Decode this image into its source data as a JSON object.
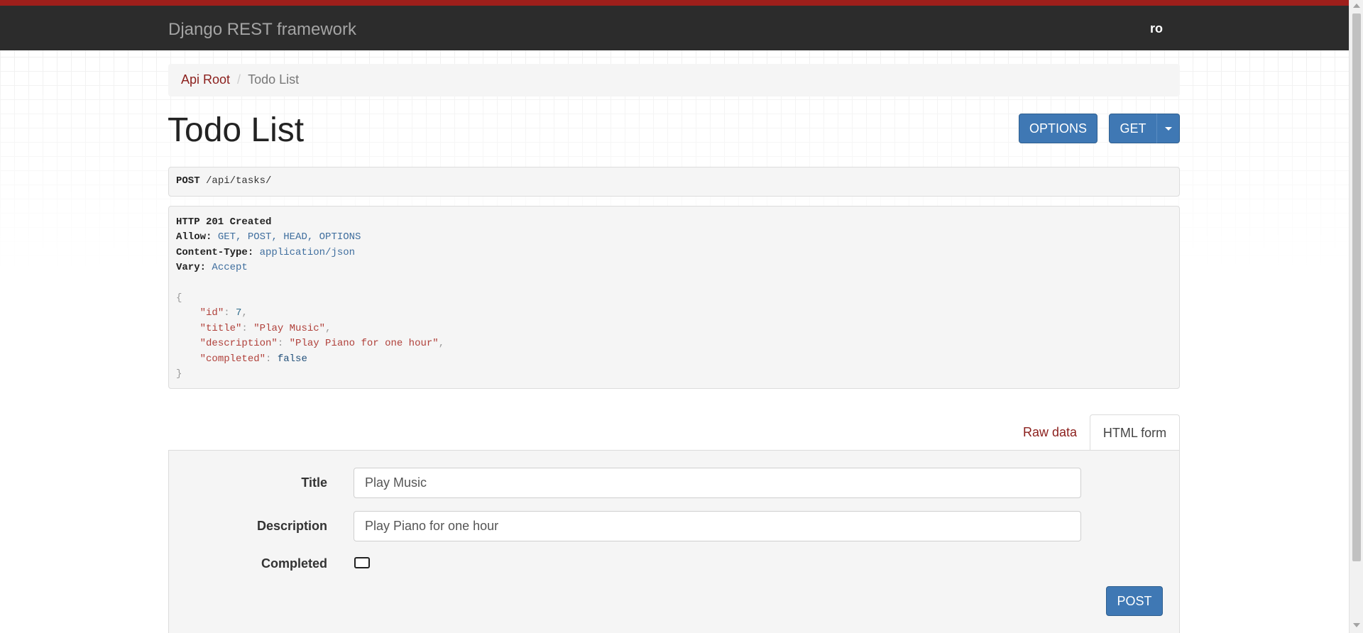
{
  "navbar": {
    "brand": "Django REST framework",
    "user": "ro",
    "accent_color": "#9e1f1b",
    "background_color": "#2c2c2c"
  },
  "breadcrumb": {
    "items": [
      {
        "label": "Api Root"
      },
      {
        "label": "Todo List"
      }
    ],
    "separator": "/"
  },
  "page": {
    "title": "Todo List"
  },
  "toolbar": {
    "options_label": "OPTIONS",
    "get_label": "GET"
  },
  "request": {
    "method": "POST",
    "path": "/api/tasks/"
  },
  "response": {
    "status": "HTTP 201 Created",
    "headers": [
      {
        "name": "Allow:",
        "value": "GET, POST, HEAD, OPTIONS"
      },
      {
        "name": "Content-Type:",
        "value": "application/json"
      },
      {
        "name": "Vary:",
        "value": "Accept"
      }
    ],
    "body": {
      "open": "{",
      "close": "}",
      "fields": [
        {
          "key": "\"id\"",
          "value": "7",
          "kind": "num",
          "trail": ","
        },
        {
          "key": "\"title\"",
          "value": "\"Play Music\"",
          "kind": "str",
          "trail": ","
        },
        {
          "key": "\"description\"",
          "value": "\"Play Piano for one hour\"",
          "kind": "str",
          "trail": ","
        },
        {
          "key": "\"completed\"",
          "value": "false",
          "kind": "lit",
          "trail": ""
        }
      ]
    }
  },
  "tabs": [
    {
      "label": "Raw data",
      "active": false
    },
    {
      "label": "HTML form",
      "active": true
    }
  ],
  "form": {
    "fields": [
      {
        "label": "Title",
        "value": "Play Music"
      },
      {
        "label": "Description",
        "value": "Play Piano for one hour"
      },
      {
        "label": "Completed",
        "checked": false
      }
    ],
    "submit_label": "POST"
  },
  "colors": {
    "primary_button": "#3f78b4",
    "link": "#8b1f1c"
  }
}
